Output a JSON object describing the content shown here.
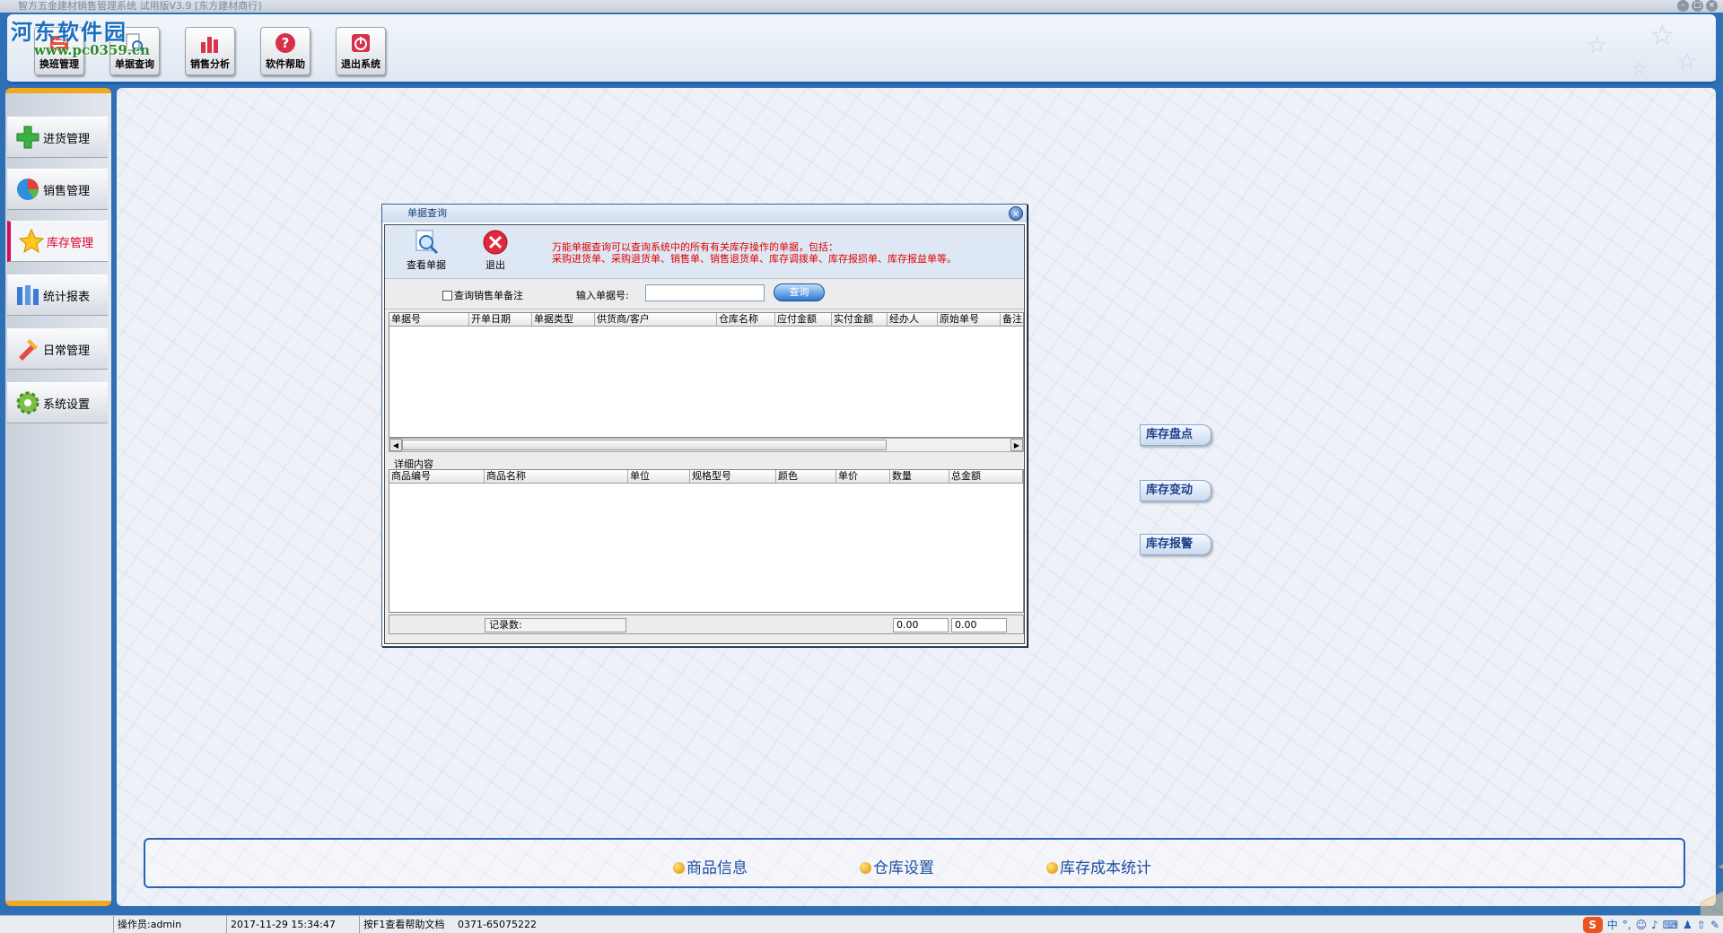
{
  "window": {
    "title": "智方五金建材销售管理系统 试用版V3.9 [东方建材商行]"
  },
  "watermark": {
    "name": "河东软件园",
    "url": "www.pc0359.cn"
  },
  "toolbar": {
    "buttons": [
      {
        "label": "换班管理",
        "icon": "swap-icon"
      },
      {
        "label": "单据查询",
        "icon": "document-search-icon"
      },
      {
        "label": "销售分析",
        "icon": "bar-chart-icon"
      },
      {
        "label": "软件帮助",
        "icon": "help-icon"
      },
      {
        "label": "退出系统",
        "icon": "power-icon"
      }
    ]
  },
  "sidebar": {
    "items": [
      {
        "label": "进货管理",
        "icon": "plus-icon",
        "active": false
      },
      {
        "label": "销售管理",
        "icon": "pie-icon",
        "active": false
      },
      {
        "label": "库存管理",
        "icon": "star-icon",
        "active": true
      },
      {
        "label": "统计报表",
        "icon": "report-icon",
        "active": false
      },
      {
        "label": "日常管理",
        "icon": "tools-icon",
        "active": false
      },
      {
        "label": "系统设置",
        "icon": "gear-icon",
        "active": false
      }
    ]
  },
  "main": {
    "side_links": [
      "库存盘点",
      "库存变动",
      "库存报警"
    ],
    "bottom_links": [
      "商品信息",
      "仓库设置",
      "库存成本统计"
    ]
  },
  "dialog": {
    "title": "单据查询",
    "tools": [
      {
        "label": "查看单据",
        "icon": "magnifier-doc-icon"
      },
      {
        "label": "退出",
        "icon": "exit-icon"
      }
    ],
    "note_line1": "万能单据查询可以查询系统中的所有有关库存操作的单据，包括：",
    "note_line2": "采购进货单、采购退货单、销售单、销售退货单、库存调拨单、库存报损单、库存报益单等。",
    "search": {
      "checkbox_label": "查询销售单备注",
      "checkbox_checked": false,
      "bill_label": "输入单据号:",
      "bill_value": "",
      "query_button": "查询"
    },
    "grid1_columns": [
      "单据号",
      "开单日期",
      "单据类型",
      "供货商/客户",
      "仓库名称",
      "应付金额",
      "实付金额",
      "经办人",
      "原始单号",
      "备注"
    ],
    "grid1_rows": [],
    "detail_label": "详细内容",
    "grid2_columns": [
      "商品编号",
      "商品名称",
      "单位",
      "规格型号",
      "颜色",
      "单价",
      "数量",
      "总金额"
    ],
    "grid2_rows": [],
    "footer": {
      "record_label": "记录数:",
      "sum1": "0.00",
      "sum2": "0.00"
    }
  },
  "statusbar": {
    "operator": "操作员:admin",
    "datetime": "2017-11-29 15:34:47",
    "hint": "按F1查看帮助文档",
    "phone": "0371-65075222",
    "ime": "S",
    "ime_mode": "中"
  },
  "colors": {
    "accent": "#2e6fb6",
    "active_label": "#e0002a",
    "sidebar_border": "#f2a81d",
    "note_text": "#e00000"
  }
}
